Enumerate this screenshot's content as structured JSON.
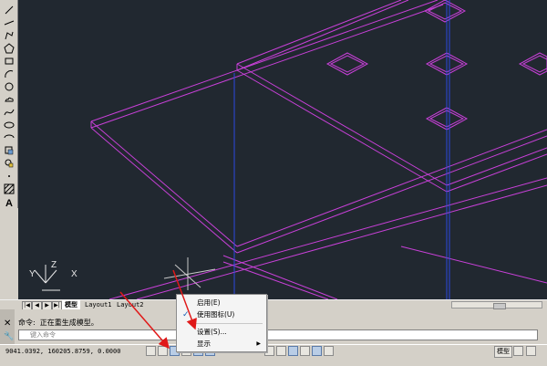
{
  "tabs": [
    "模型",
    "Layout1",
    "Layout2"
  ],
  "command": {
    "label": "命令:",
    "history": "正在重生成模型。",
    "placeholder": "键入命令"
  },
  "status": {
    "coords": "9041.0392,  160205.8759,  0.0000",
    "model_label": "模型"
  },
  "context_menu": {
    "items": [
      {
        "label": "启用(E)",
        "checked": false
      },
      {
        "label": "使用图标(U)",
        "checked": true
      },
      {
        "label": "设置(S)...",
        "checked": false
      },
      {
        "label": "显示",
        "checked": false,
        "submenu": true
      }
    ]
  },
  "ucs": {
    "x": "X",
    "y": "Y",
    "z": "Z"
  },
  "colors": {
    "canvas": "#212830",
    "magenta": "#c840d8",
    "blue": "#2a48e0",
    "arrow": "#e01818"
  }
}
